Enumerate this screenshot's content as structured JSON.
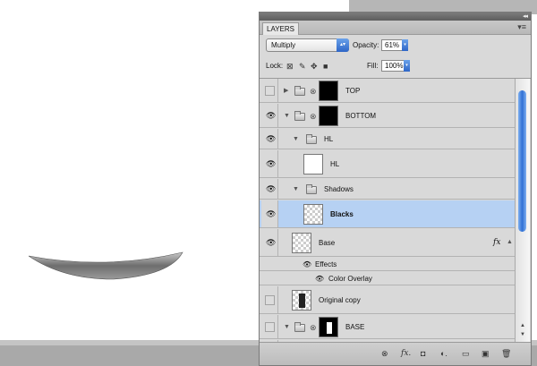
{
  "panel": {
    "tab": "LAYERS",
    "collapse_icon": "double-chevron-right-icon",
    "menu_icon": "panel-menu-icon"
  },
  "options": {
    "blend_mode": "Multiply",
    "opacity_label": "Opacity:",
    "opacity": "61%",
    "lock_label": "Lock:",
    "fill_label": "Fill:",
    "fill": "100%"
  },
  "layers": [
    {
      "name": "TOP",
      "visible": false,
      "type": "group"
    },
    {
      "name": "BOTTOM",
      "visible": true,
      "type": "group"
    },
    {
      "name": "HL",
      "visible": true,
      "type": "group"
    },
    {
      "name": "HL",
      "visible": true,
      "type": "layer"
    },
    {
      "name": "Shadows",
      "visible": true,
      "type": "group"
    },
    {
      "name": "Blacks",
      "visible": true,
      "type": "layer",
      "selected": true
    },
    {
      "name": "Base",
      "visible": true,
      "type": "layer",
      "fx": "fx"
    },
    {
      "name": "Effects",
      "type": "effects-header"
    },
    {
      "name": "Color Overlay",
      "type": "effect"
    },
    {
      "name": "Original copy",
      "visible": false,
      "type": "layer"
    },
    {
      "name": "BASE",
      "visible": false,
      "type": "group"
    }
  ],
  "colors": {
    "selected_row": "#b6d1f3",
    "accent": "#2e66c7"
  }
}
